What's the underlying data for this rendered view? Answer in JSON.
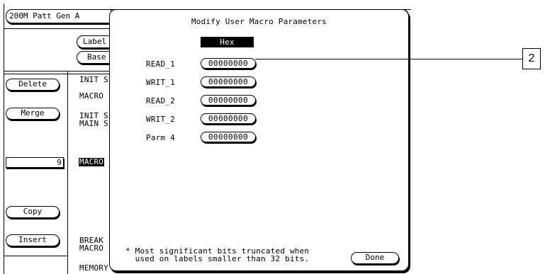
{
  "background": {
    "title_button": "200M Patt Gen A",
    "label_button_text": "Label",
    "base_button_text": "Base",
    "left_buttons": {
      "delete": "Delete",
      "merge": "Merge",
      "count_value": "9",
      "copy": "Copy",
      "insert": "Insert"
    },
    "list_rows": {
      "init1": "INIT S",
      "macro1": "MACRO",
      "init2": "INIT S",
      "main": "MAIN S",
      "macro_highlight": "MACRO",
      "break": "BREAK",
      "macro3": "MACRO",
      "memory": "MEMORY"
    }
  },
  "dialog": {
    "title": "Modify User Macro Parameters",
    "header": "Hex",
    "params": [
      {
        "name": "READ_1",
        "value": "00000000"
      },
      {
        "name": "WRIT_1",
        "value": "00000000"
      },
      {
        "name": "READ_2",
        "value": "00000000"
      },
      {
        "name": "WRIT_2",
        "value": "00000000"
      },
      {
        "name": "Parm 4",
        "value": "00000000"
      }
    ],
    "note_line1": "* Most significant bits truncated when",
    "note_line2": "  used on labels smaller than 32 bits.",
    "done": "Done"
  },
  "callout": "2"
}
